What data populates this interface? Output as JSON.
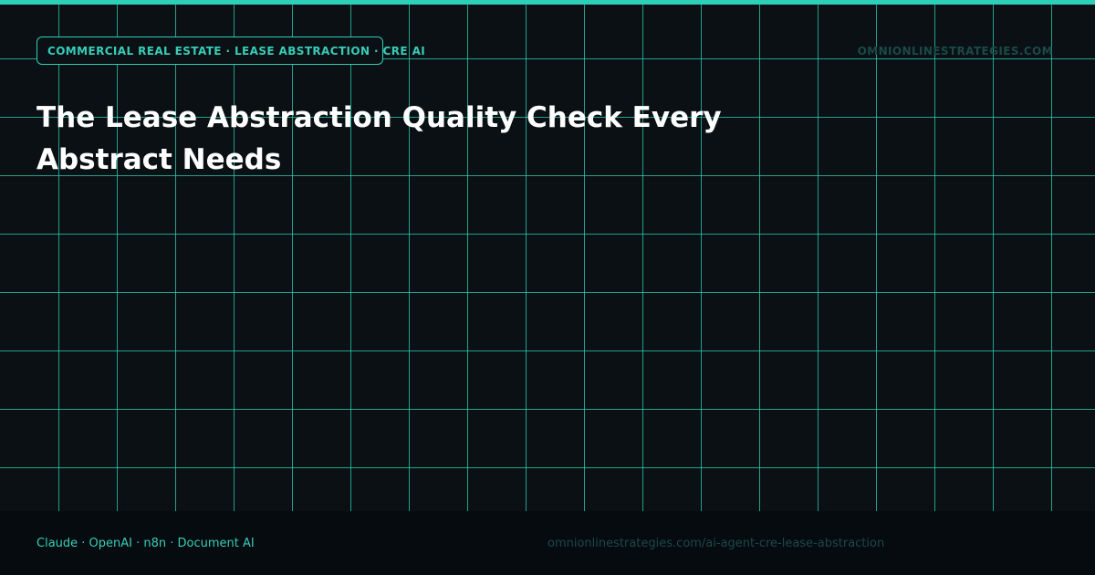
{
  "header": {
    "tag": "COMMERCIAL REAL ESTATE · LEASE ABSTRACTION · CRE AI",
    "domain": "OMNIONLINESTRATEGIES.COM"
  },
  "headline": "The Lease Abstraction Quality Check Every Abstract Needs",
  "footer": {
    "tools": "Claude · OpenAI · n8n · Document AI",
    "url": "omnionlinestrategies.com/ai-agent-cre-lease-abstraction"
  },
  "colors": {
    "accent": "#2ecfb8",
    "background": "#0a1013",
    "footer_background": "#050b0e",
    "headline": "#ffffff",
    "muted": "#1c4a45"
  }
}
